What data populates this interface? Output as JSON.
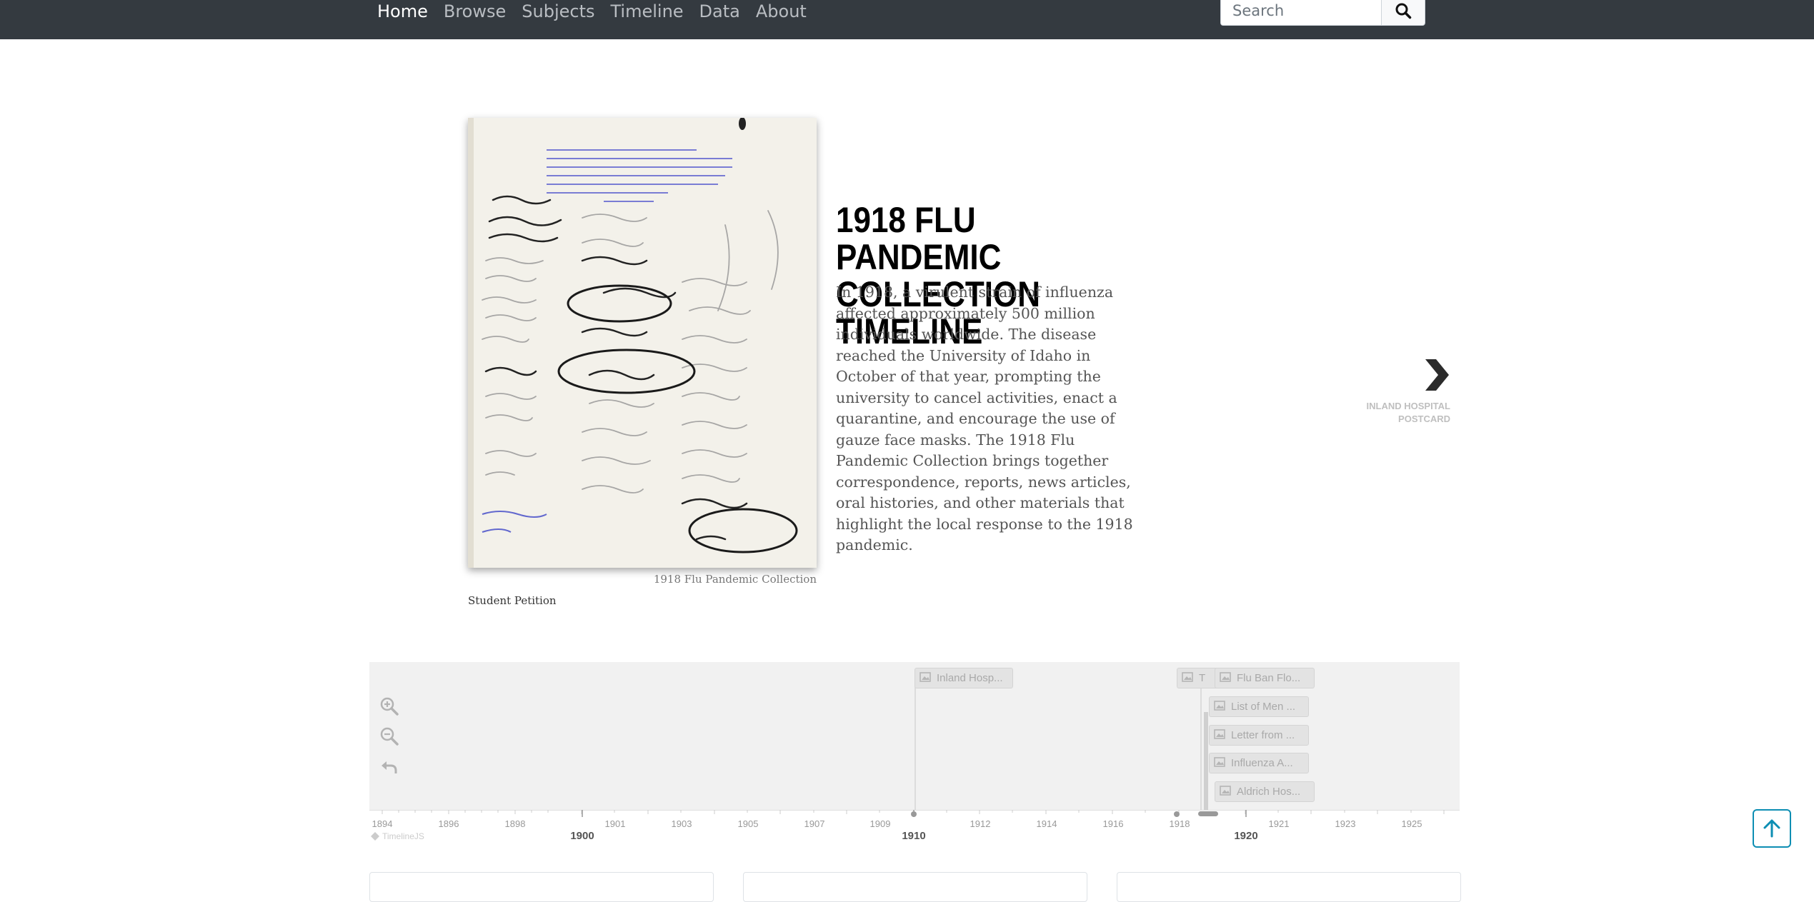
{
  "nav": {
    "items": [
      {
        "label": "Home",
        "active": true
      },
      {
        "label": "Browse"
      },
      {
        "label": "Subjects"
      },
      {
        "label": "Timeline"
      },
      {
        "label": "Data"
      },
      {
        "label": "About"
      }
    ]
  },
  "search": {
    "placeholder": "Search",
    "button_icon": "search-icon"
  },
  "slide": {
    "image_icon": "document-photo",
    "image_credit": "1918 Flu Pandemic Collection",
    "image_caption": "Student Petition",
    "title": "1918 FLU PANDEMIC COLLECTION TIMELINE",
    "text": "In 1918, a virulent strain of influenza affected approximately 500 million individuals worldwide. The disease reached the University of Idaho in October of that year, prompting the university to cancel activities, enact a quarantine, and encourage the use of gauze face masks. The 1918 Flu Pandemic Collection brings together correspondence, reports, news articles, oral histories, and other materials that highlight the local response to the 1918 pandemic."
  },
  "next": {
    "icon": "chevron-right-icon",
    "title_line1": "INLAND HOSPITAL",
    "title_line2": "POSTCARD"
  },
  "timeline": {
    "markers": [
      {
        "label": "Inland Hosp..."
      },
      {
        "label": "T"
      },
      {
        "label": "Flu Ban Flo..."
      },
      {
        "label": "List of Men ..."
      },
      {
        "label": "Letter from ..."
      },
      {
        "label": "Influenza A..."
      },
      {
        "label": "Aldrich Hos..."
      }
    ],
    "ticks": [
      "1894",
      "1896",
      "1898",
      "1901",
      "1903",
      "1905",
      "1907",
      "1909",
      "1912",
      "1914",
      "1916",
      "1918",
      "1921",
      "1923",
      "1925"
    ],
    "major_ticks": [
      "1900",
      "1910",
      "1920"
    ],
    "credit": "TimelineJS"
  },
  "colors": {
    "navbar": "#343a40",
    "accent": "#0d8eb3"
  }
}
